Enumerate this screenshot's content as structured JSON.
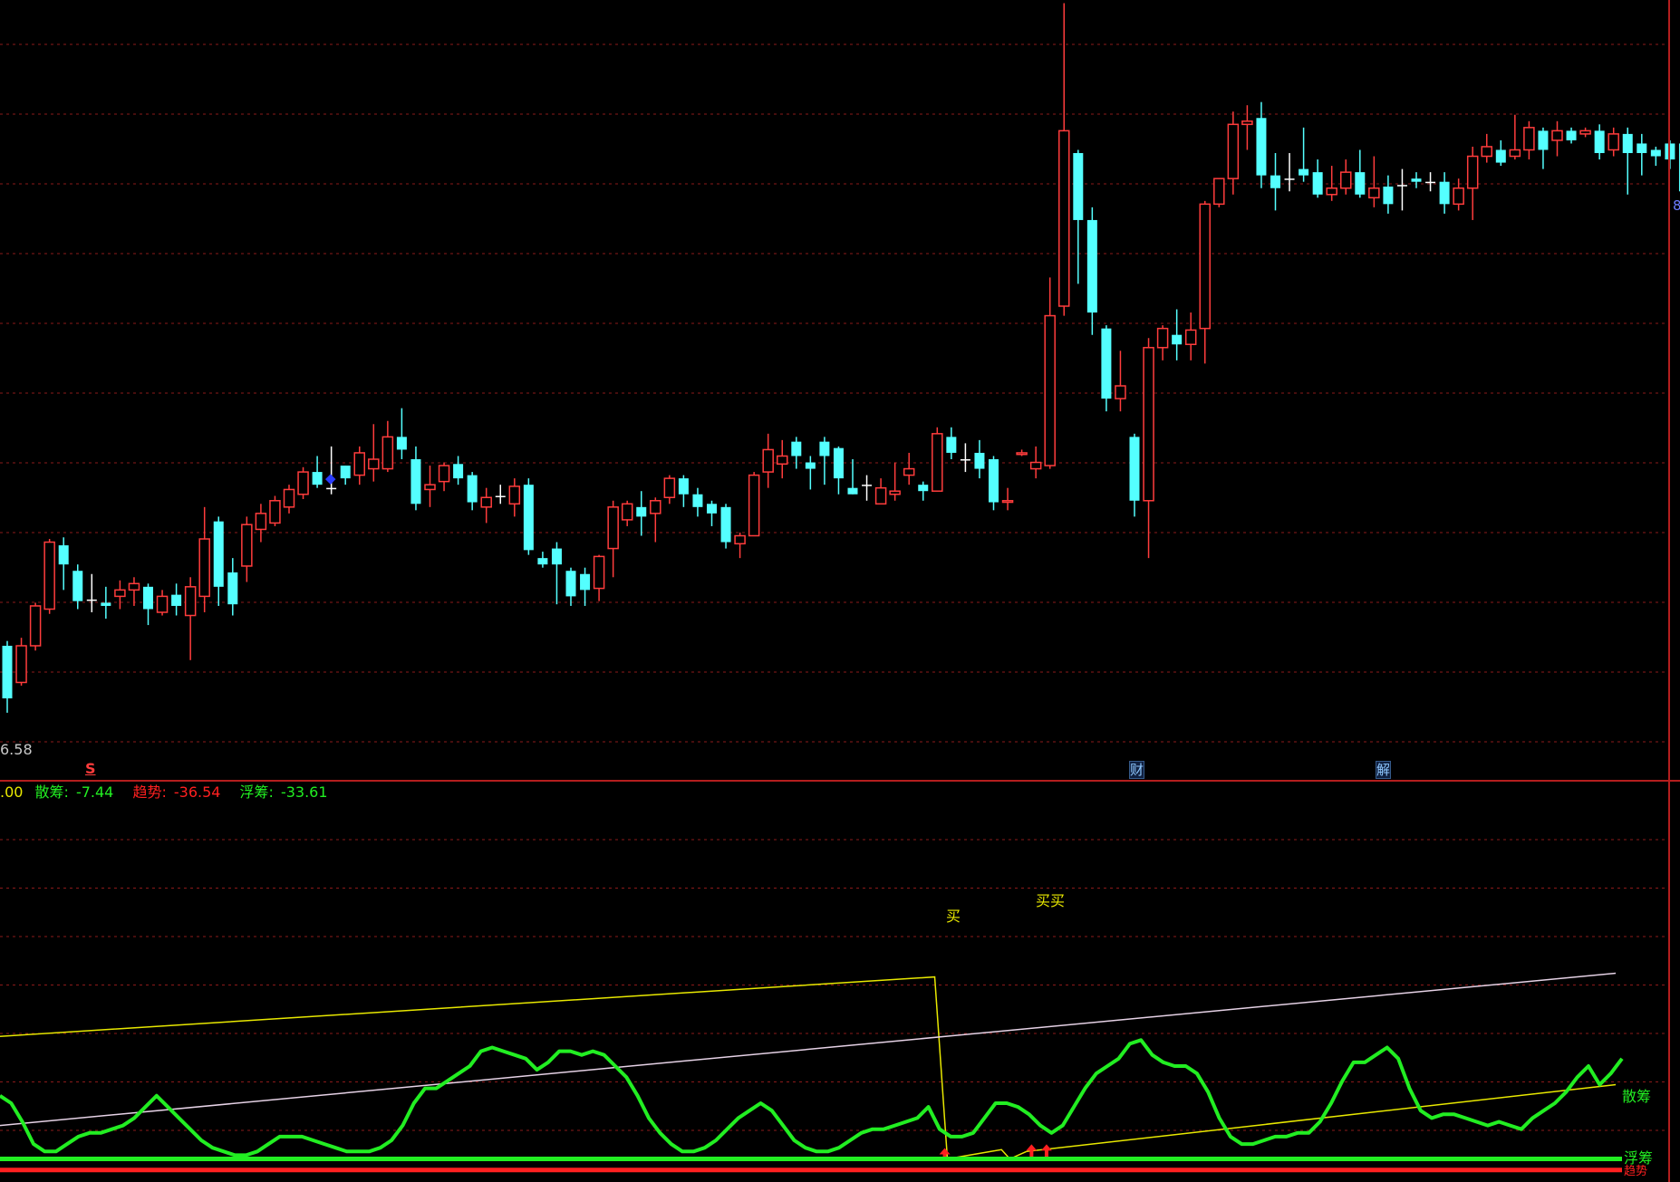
{
  "colors": {
    "background": "#000000",
    "grid": "#8b1a1a",
    "up": "#ff3c3c",
    "down": "#54ffff",
    "ma_yellow": "#e8e800",
    "ma_white": "#e6d2e6",
    "green": "#22ee22",
    "red": "#ff2020",
    "marker_blue": "#2a3cff"
  },
  "price_panel": {
    "bottom_label": "6.58",
    "right_label": "8",
    "markers": [
      {
        "name": "s-marker",
        "text": "S",
        "color": "#ff3c3c"
      },
      {
        "name": "cai-marker",
        "text": "财",
        "color": "#8fc8ff"
      },
      {
        "name": "jie-marker",
        "text": "解",
        "color": "#8fc8ff"
      }
    ],
    "blue_tag": "◆",
    "cross_candle_glyph": "十"
  },
  "indicator_panel": {
    "legend_prefix": ".00",
    "legend": [
      {
        "label": "散筹:",
        "value": "-7.44",
        "color": "#22ee22"
      },
      {
        "label": "趋势:",
        "value": "-36.54",
        "color": "#ff2020"
      },
      {
        "label": "浮筹:",
        "value": "-33.61",
        "color": "#22ee22"
      }
    ],
    "buy_labels": [
      "买",
      "买买"
    ],
    "end_labels": {
      "sanchou": "散筹",
      "fuchou": "浮筹",
      "qushi": "趋势"
    }
  },
  "chart_data": [
    {
      "type": "candlestick",
      "title": "",
      "axis_low_label": 6.58,
      "ylim": [
        6.3,
        11.1
      ],
      "candles": [
        [
          7.05,
          6.72,
          7.08,
          6.63
        ],
        [
          6.82,
          7.05,
          7.1,
          6.8
        ],
        [
          7.05,
          7.3,
          7.32,
          7.02
        ],
        [
          7.28,
          7.7,
          7.72,
          7.25
        ],
        [
          7.68,
          7.56,
          7.73,
          7.4
        ],
        [
          7.52,
          7.33,
          7.56,
          7.28
        ],
        [
          7.34,
          7.34,
          7.5,
          7.26
        ],
        [
          7.32,
          7.3,
          7.42,
          7.22
        ],
        [
          7.36,
          7.4,
          7.46,
          7.28
        ],
        [
          7.4,
          7.44,
          7.48,
          7.3
        ],
        [
          7.42,
          7.28,
          7.44,
          7.18
        ],
        [
          7.26,
          7.36,
          7.4,
          7.24
        ],
        [
          7.37,
          7.3,
          7.44,
          7.24
        ],
        [
          7.24,
          7.42,
          7.48,
          6.96
        ],
        [
          7.36,
          7.72,
          7.92,
          7.26
        ],
        [
          7.83,
          7.42,
          7.86,
          7.3
        ],
        [
          7.51,
          7.31,
          7.6,
          7.24
        ],
        [
          7.55,
          7.81,
          7.86,
          7.45
        ],
        [
          7.78,
          7.88,
          7.94,
          7.7
        ],
        [
          7.82,
          7.96,
          7.99,
          7.8
        ],
        [
          7.92,
          8.03,
          8.06,
          7.88
        ],
        [
          8.0,
          8.14,
          8.17,
          7.97
        ],
        [
          8.14,
          8.06,
          8.24,
          8.04
        ],
        [
          8.04,
          8.04,
          8.3,
          8.0
        ],
        [
          8.18,
          8.1,
          8.18,
          8.06
        ],
        [
          8.12,
          8.26,
          8.3,
          8.06
        ],
        [
          8.16,
          8.22,
          8.44,
          8.08
        ],
        [
          8.16,
          8.36,
          8.46,
          8.14
        ],
        [
          8.36,
          8.28,
          8.54,
          8.22
        ],
        [
          8.22,
          7.94,
          8.3,
          7.9
        ],
        [
          8.03,
          8.06,
          8.18,
          7.92
        ],
        [
          8.08,
          8.18,
          8.2,
          8.02
        ],
        [
          8.19,
          8.1,
          8.24,
          8.06
        ],
        [
          8.12,
          7.95,
          8.14,
          7.9
        ],
        [
          7.92,
          7.98,
          8.04,
          7.82
        ],
        [
          7.99,
          7.99,
          8.06,
          7.94
        ],
        [
          7.94,
          8.05,
          8.1,
          7.86
        ],
        [
          8.06,
          7.65,
          8.1,
          7.62
        ],
        [
          7.6,
          7.56,
          7.64,
          7.54
        ],
        [
          7.66,
          7.56,
          7.7,
          7.31
        ],
        [
          7.52,
          7.36,
          7.54,
          7.3
        ],
        [
          7.5,
          7.4,
          7.54,
          7.3
        ],
        [
          7.41,
          7.61,
          7.62,
          7.33
        ],
        [
          7.66,
          7.92,
          7.96,
          7.48
        ],
        [
          7.84,
          7.94,
          7.96,
          7.8
        ],
        [
          7.92,
          7.86,
          8.02,
          7.74
        ],
        [
          7.88,
          7.96,
          7.98,
          7.7
        ],
        [
          7.98,
          8.1,
          8.12,
          7.94
        ],
        [
          8.1,
          8.0,
          8.12,
          7.92
        ],
        [
          8.0,
          7.92,
          8.04,
          7.86
        ],
        [
          7.94,
          7.88,
          7.96,
          7.8
        ],
        [
          7.92,
          7.7,
          7.94,
          7.66
        ],
        [
          7.69,
          7.74,
          7.76,
          7.6
        ],
        [
          7.74,
          8.12,
          8.14,
          7.74
        ],
        [
          8.14,
          8.28,
          8.38,
          8.04
        ],
        [
          8.19,
          8.24,
          8.34,
          8.1
        ],
        [
          8.33,
          8.24,
          8.36,
          8.16
        ],
        [
          8.2,
          8.16,
          8.24,
          8.03
        ],
        [
          8.33,
          8.24,
          8.36,
          8.06
        ],
        [
          8.29,
          8.1,
          8.3,
          8.0
        ],
        [
          8.04,
          8.0,
          8.22,
          8.0
        ],
        [
          8.06,
          8.06,
          8.12,
          7.96
        ],
        [
          7.94,
          8.04,
          8.1,
          7.96
        ],
        [
          8.0,
          8.02,
          8.2,
          7.96
        ],
        [
          8.12,
          8.16,
          8.26,
          8.06
        ],
        [
          8.06,
          8.02,
          8.08,
          7.96
        ],
        [
          8.02,
          8.38,
          8.42,
          8.02
        ],
        [
          8.36,
          8.26,
          8.42,
          8.22
        ],
        [
          8.22,
          8.22,
          8.32,
          8.14
        ],
        [
          8.26,
          8.16,
          8.34,
          8.1
        ],
        [
          8.22,
          7.95,
          8.24,
          7.9
        ],
        [
          7.95,
          7.96,
          8.04,
          7.9
        ],
        [
          8.25,
          8.26,
          8.28,
          8.24
        ],
        [
          8.16,
          8.2,
          8.3,
          8.1
        ],
        [
          8.18,
          9.12,
          9.36,
          8.16
        ],
        [
          9.18,
          10.28,
          11.08,
          9.12
        ],
        [
          10.14,
          9.72,
          10.16,
          9.32
        ],
        [
          9.72,
          9.14,
          9.8,
          9.0
        ],
        [
          9.04,
          8.6,
          9.06,
          8.52
        ],
        [
          8.6,
          8.68,
          8.9,
          8.52
        ],
        [
          8.36,
          7.96,
          8.38,
          7.86
        ],
        [
          7.96,
          8.92,
          8.98,
          7.6
        ],
        [
          8.92,
          9.04,
          9.06,
          8.84
        ],
        [
          9.0,
          8.94,
          9.16,
          8.84
        ],
        [
          8.94,
          9.03,
          9.14,
          8.84
        ],
        [
          9.04,
          9.82,
          9.84,
          8.82
        ],
        [
          9.82,
          9.98,
          9.98,
          9.8
        ],
        [
          9.98,
          10.32,
          10.4,
          9.88
        ],
        [
          10.32,
          10.34,
          10.44,
          10.16
        ],
        [
          10.36,
          10.0,
          10.46,
          9.92
        ],
        [
          10.0,
          9.92,
          10.14,
          9.78
        ],
        [
          9.98,
          9.98,
          10.14,
          9.9
        ],
        [
          10.04,
          10.0,
          10.3,
          9.96
        ],
        [
          10.02,
          9.88,
          10.1,
          9.86
        ],
        [
          9.88,
          9.92,
          10.06,
          9.84
        ],
        [
          9.92,
          10.02,
          10.1,
          9.88
        ],
        [
          10.02,
          9.88,
          10.16,
          9.86
        ],
        [
          9.86,
          9.92,
          10.12,
          9.8
        ],
        [
          9.93,
          9.82,
          10.0,
          9.76
        ],
        [
          9.94,
          9.94,
          10.04,
          9.78
        ],
        [
          9.98,
          9.96,
          10.02,
          9.92
        ],
        [
          9.96,
          9.96,
          10.02,
          9.9
        ],
        [
          9.96,
          9.82,
          10.02,
          9.76
        ],
        [
          9.82,
          9.92,
          9.98,
          9.78
        ],
        [
          9.92,
          10.12,
          10.18,
          9.72
        ],
        [
          10.12,
          10.18,
          10.26,
          10.08
        ],
        [
          10.16,
          10.08,
          10.22,
          10.06
        ],
        [
          10.12,
          10.16,
          10.38,
          10.1
        ],
        [
          10.16,
          10.3,
          10.34,
          10.1
        ],
        [
          10.28,
          10.16,
          10.3,
          10.04
        ],
        [
          10.22,
          10.28,
          10.34,
          10.12
        ],
        [
          10.28,
          10.22,
          10.3,
          10.2
        ],
        [
          10.26,
          10.28,
          10.3,
          10.24
        ],
        [
          10.28,
          10.14,
          10.32,
          10.1
        ],
        [
          10.16,
          10.26,
          10.3,
          10.12
        ],
        [
          10.26,
          10.14,
          10.3,
          9.88
        ],
        [
          10.2,
          10.14,
          10.26,
          10.0
        ],
        [
          10.16,
          10.12,
          10.18,
          10.06
        ],
        [
          10.2,
          10.1,
          10.22,
          10.04
        ],
        [
          10.2,
          9.9,
          10.24,
          9.88
        ],
        [
          9.98,
          9.84,
          10.04,
          9.72
        ],
        [
          10.18,
          9.86,
          10.2,
          9.82
        ],
        [
          9.9,
          9.6,
          9.92,
          9.58
        ]
      ]
    },
    {
      "type": "line",
      "title": "",
      "ylim": [
        0,
        100
      ],
      "series": [
        {
          "name": "散筹",
          "color": "#22ee22",
          "width": 4,
          "values": [
            22,
            20,
            15,
            9,
            7,
            7,
            9,
            11,
            12,
            12,
            13,
            14,
            16,
            19,
            22,
            19,
            16,
            13,
            10,
            8,
            7,
            6,
            6,
            7,
            9,
            11,
            11,
            11,
            10,
            9,
            8,
            7,
            7,
            7,
            8,
            10,
            14,
            20,
            24,
            24,
            26,
            28,
            30,
            34,
            35,
            34,
            33,
            32,
            29,
            31,
            34,
            34,
            33,
            34,
            33,
            30,
            27,
            22,
            16,
            12,
            9,
            7,
            7,
            8,
            10,
            13,
            16,
            18,
            20,
            18,
            14,
            10,
            8,
            7,
            7,
            8,
            10,
            12,
            13,
            13,
            14,
            15,
            16,
            19,
            13,
            11,
            11,
            12,
            16,
            20,
            20,
            19,
            17,
            14,
            12,
            14,
            19,
            24,
            28,
            30,
            32,
            36,
            37,
            33,
            31,
            30,
            30,
            28,
            23,
            16,
            11,
            9,
            9,
            10,
            11,
            11,
            12,
            12,
            15,
            20,
            26,
            31,
            31,
            33,
            35,
            32,
            24,
            18,
            16,
            17,
            17,
            16,
            15,
            14,
            15,
            14,
            13,
            16,
            18,
            20,
            23,
            27,
            30,
            25,
            28,
            32
          ],
          "end_label": "散筹"
        },
        {
          "name": "浮筹",
          "color": "#22ee22",
          "width": 5,
          "flat_value": 5,
          "end_label": "浮筹"
        },
        {
          "name": "趋势",
          "color": "#ff2020",
          "width": 5,
          "flat_value": 2,
          "end_label": "趋势"
        }
      ],
      "ma_lines": [
        {
          "name": "yellow-upper",
          "color": "#e8e800",
          "from": [
            0,
            38
          ],
          "to": [
            0.56,
            54
          ],
          "drop_to": 5
        },
        {
          "name": "yellow-lower",
          "color": "#e8e800",
          "from": [
            0.615,
            7
          ],
          "to": [
            0.968,
            25
          ]
        },
        {
          "name": "white",
          "color": "#e6d2e6",
          "from": [
            0,
            14
          ],
          "to": [
            0.968,
            55
          ]
        }
      ]
    }
  ]
}
